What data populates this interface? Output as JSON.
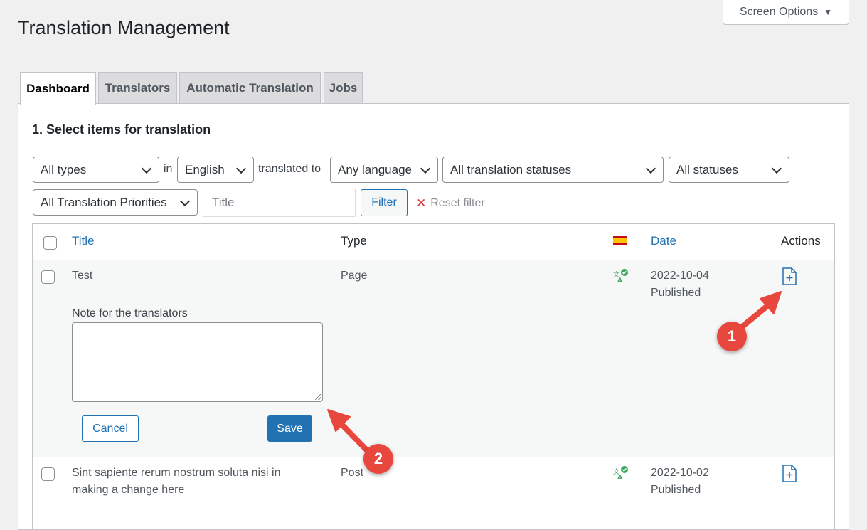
{
  "screen_options": {
    "label": "Screen Options"
  },
  "page_title": "Translation Management",
  "tabs": [
    {
      "label": "Dashboard",
      "active": true
    },
    {
      "label": "Translators"
    },
    {
      "label": "Automatic Translation"
    },
    {
      "label": "Jobs"
    }
  ],
  "section_title": "1. Select items for translation",
  "filters": {
    "type": "All types",
    "in_word": "in",
    "source_language": "English",
    "translated_to_word": "translated to",
    "target_language": "Any language",
    "translation_status": "All translation statuses",
    "status": "All statuses",
    "priority": "All Translation Priorities",
    "title_placeholder": "Title",
    "filter_button": "Filter",
    "reset_label": "Reset filter"
  },
  "table": {
    "headers": {
      "title": "Title",
      "type": "Type",
      "date": "Date",
      "actions": "Actions"
    },
    "rows": [
      {
        "title": "Test",
        "type": "Page",
        "date": "2022-10-04",
        "status": "Published"
      },
      {
        "title_line1": "Sint sapiente rerum nostrum soluta nisi in",
        "title_line2": "making a change here",
        "type": "Post",
        "date": "2022-10-02",
        "status": "Published"
      }
    ]
  },
  "note": {
    "label": "Note for the translators",
    "value": "",
    "cancel_label": "Cancel",
    "save_label": "Save"
  },
  "callouts": {
    "one": "1",
    "two": "2"
  },
  "icons": {
    "flag": "spain-flag-icon",
    "translation_status": "translated-check-icon",
    "add_translation": "add-document-icon",
    "dropdown": "chevron-down-icon",
    "reset": "close-icon"
  },
  "colors": {
    "accent": "#2271b1",
    "callout": "#e8473e",
    "success": "#3ba55c",
    "flag_red": "#c60b1e",
    "flag_yellow": "#ffc400"
  }
}
